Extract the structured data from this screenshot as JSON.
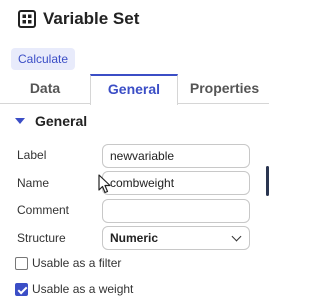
{
  "window": {
    "title": "Variable Set"
  },
  "toolbar": {
    "calculate_label": "Calculate"
  },
  "tabs": [
    {
      "label": "Data"
    },
    {
      "label": "General",
      "active": true
    },
    {
      "label": "Properties"
    }
  ],
  "section": {
    "title": "General"
  },
  "fields": {
    "label": {
      "label": "Label",
      "value": "newvariable"
    },
    "name": {
      "label": "Name",
      "value": "combweight"
    },
    "comment": {
      "label": "Comment",
      "value": ""
    },
    "structure": {
      "label": "Structure",
      "value": "Numeric"
    }
  },
  "options": {
    "filter": {
      "label": "Usable as a filter",
      "checked": false
    },
    "weight": {
      "label": "Usable as a weight",
      "checked": true
    }
  },
  "colors": {
    "accent": "#3b4ec6",
    "accent_bg": "#e8ebfb"
  },
  "icons": {
    "title": "grid-icon",
    "section": "caret-down-icon",
    "select": "chevron-down-icon"
  }
}
